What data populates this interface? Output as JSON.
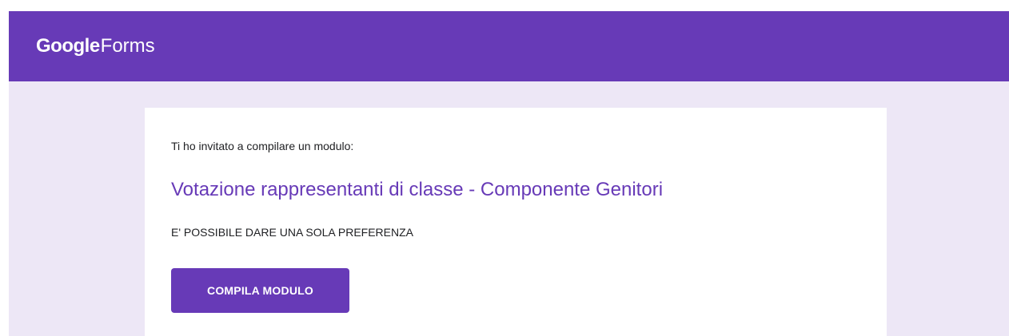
{
  "header": {
    "brand_primary": "Google",
    "brand_secondary": "Forms",
    "background_color": "#673ab7"
  },
  "page": {
    "background_color": "#ede7f6"
  },
  "card": {
    "invite_text": "Ti ho invitato a compilare un modulo:",
    "form_title": "Votazione rappresentanti di classe - Componente Genitori",
    "form_description": "E' POSSIBILE DARE UNA SOLA PREFERENZA",
    "button_label": "COMPILA MODULO",
    "accent_color": "#673ab7"
  }
}
